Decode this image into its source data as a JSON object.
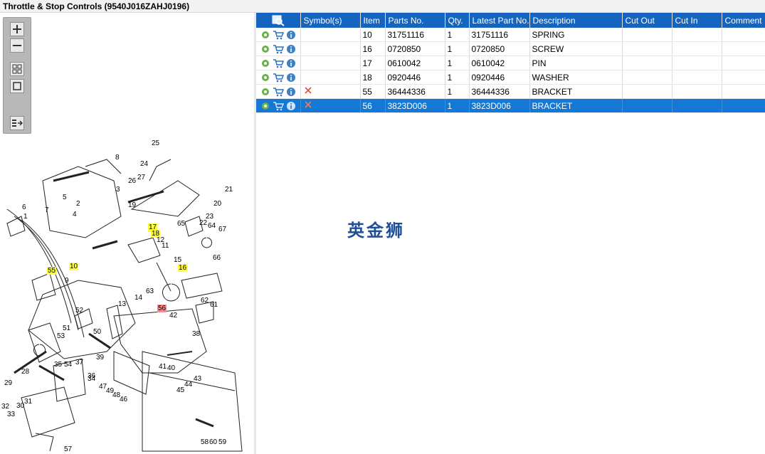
{
  "window": {
    "title": "Throttle & Stop Controls (9540J016ZAHJ0196)"
  },
  "toolbar": {
    "buttons": [
      {
        "name": "zoom-in",
        "icon": "plus-icon"
      },
      {
        "name": "zoom-out",
        "icon": "minus-icon"
      },
      {
        "name": "fit-all",
        "icon": "grid-icon"
      },
      {
        "name": "actual-size",
        "icon": "square-icon"
      },
      {
        "name": "toggle-list",
        "icon": "list-arrow-icon"
      }
    ]
  },
  "diagram": {
    "callouts": [
      "25",
      "8",
      "24",
      "21",
      "3",
      "26",
      "27",
      "7",
      "22",
      "6",
      "5",
      "1",
      "19",
      "23",
      "20",
      "2",
      "4",
      "17",
      "18",
      "12",
      "11",
      "65",
      "64",
      "67",
      "10",
      "55",
      "9",
      "15",
      "16",
      "66",
      "52",
      "13",
      "14",
      "63",
      "62",
      "61",
      "56",
      "42",
      "51",
      "50",
      "38",
      "53",
      "39",
      "36",
      "35",
      "37",
      "54",
      "34",
      "29",
      "28",
      "33",
      "30",
      "31",
      "32",
      "47",
      "49",
      "48",
      "46",
      "40",
      "41",
      "44",
      "43",
      "45",
      "57",
      "58",
      "60",
      "59"
    ],
    "highlighted": [
      "17",
      "18",
      "10",
      "55",
      "16"
    ],
    "selected": [
      "56"
    ]
  },
  "table": {
    "search_icon": "search-icon",
    "columns": [
      "",
      "Symbol(s)",
      "Item",
      "Parts No.",
      "Qty.",
      "Latest Part No.",
      "Description",
      "Cut Out",
      "Cut In",
      "Comment"
    ],
    "rows": [
      {
        "item": "10",
        "parts_no": "31751116",
        "qty": "1",
        "latest": "31751116",
        "description": "SPRING",
        "symbol": "",
        "selected": false
      },
      {
        "item": "16",
        "parts_no": "0720850",
        "qty": "1",
        "latest": "0720850",
        "description": "SCREW",
        "symbol": "",
        "selected": false
      },
      {
        "item": "17",
        "parts_no": "0610042",
        "qty": "1",
        "latest": "0610042",
        "description": "PIN",
        "symbol": "",
        "selected": false
      },
      {
        "item": "18",
        "parts_no": "0920446",
        "qty": "1",
        "latest": "0920446",
        "description": "WASHER",
        "symbol": "",
        "selected": false
      },
      {
        "item": "55",
        "parts_no": "36444336",
        "qty": "1",
        "latest": "36444336",
        "description": "BRACKET",
        "symbol": "x",
        "selected": false
      },
      {
        "item": "56",
        "parts_no": "3823D006",
        "qty": "1",
        "latest": "3823D006",
        "description": "BRACKET",
        "symbol": "x",
        "selected": true
      }
    ]
  },
  "watermark": "英金狮",
  "colors": {
    "header_bg": "#1565c0",
    "selected_row": "#1478d4",
    "highlight": "#ffff3a",
    "selected_callout": "#ff8a8a",
    "watermark": "#1e4f98"
  }
}
